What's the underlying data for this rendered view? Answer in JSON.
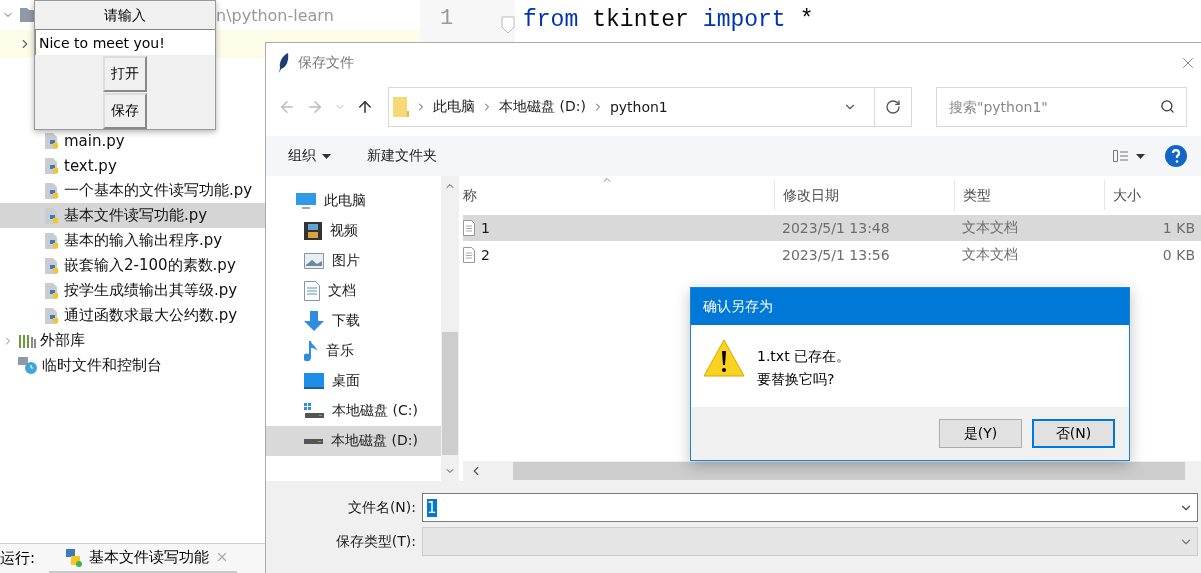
{
  "ide": {
    "path_fragment": "n\\python-learn",
    "files": [
      {
        "name": "main.py",
        "selected": false
      },
      {
        "name": "text.py",
        "selected": false
      },
      {
        "name": "一个基本的文件读写功能.py",
        "selected": false
      },
      {
        "name": "基本文件读写功能.py",
        "selected": true
      },
      {
        "name": "基本的输入输出程序.py",
        "selected": false
      },
      {
        "name": "嵌套输入2-100的素数.py",
        "selected": false
      },
      {
        "name": "按学生成绩输出其等级.py",
        "selected": false
      },
      {
        "name": "通过函数求最大公约数.py",
        "selected": false
      }
    ],
    "other_items": [
      {
        "label": "外部库",
        "kind": "library"
      },
      {
        "label": "临时文件和控制台",
        "kind": "scratch"
      }
    ],
    "editor": {
      "line_number": "1",
      "tokens": [
        {
          "text": "from",
          "kind": "keyword"
        },
        {
          "text": "tkinter",
          "kind": "plain"
        },
        {
          "text": "import",
          "kind": "keyword"
        },
        {
          "text": "*",
          "kind": "plain"
        }
      ]
    },
    "run_bar": {
      "label": "运行:",
      "tab": "基本文件读写功能"
    }
  },
  "tk_window": {
    "title": "请输入",
    "entry_value": "Nice to meet you!",
    "buttons": [
      "打开",
      "保存"
    ]
  },
  "save_dialog": {
    "title": "保存文件",
    "breadcrumbs": [
      "此电脑",
      "本地磁盘 (D:)",
      "python1"
    ],
    "search": {
      "placeholder": "搜索\"python1\""
    },
    "toolbar": {
      "organize": "组织",
      "new_folder": "新建文件夹"
    },
    "nav": [
      {
        "label": "此电脑",
        "kind": "pc",
        "selected": false,
        "children": [
          {
            "label": "视频",
            "kind": "video",
            "selected": false
          },
          {
            "label": "图片",
            "kind": "pictures",
            "selected": false
          },
          {
            "label": "文档",
            "kind": "documents",
            "selected": false
          },
          {
            "label": "下载",
            "kind": "downloads",
            "selected": false
          },
          {
            "label": "音乐",
            "kind": "music",
            "selected": false
          },
          {
            "label": "桌面",
            "kind": "desktop",
            "selected": false
          },
          {
            "label": "本地磁盘 (C:)",
            "kind": "system_drive",
            "selected": false
          },
          {
            "label": "本地磁盘 (D:)",
            "kind": "drive",
            "selected": true
          }
        ]
      }
    ],
    "columns": [
      "称",
      "修改日期",
      "类型",
      "大小"
    ],
    "rows": [
      {
        "name": "1",
        "modified": "2023/5/1 13:48",
        "type": "文本文档",
        "size": "1 KB",
        "selected": true
      },
      {
        "name": "2",
        "modified": "2023/5/1 13:56",
        "type": "文本文档",
        "size": "0 KB",
        "selected": false
      }
    ],
    "filename": {
      "label": "文件名(N):",
      "value": "1",
      "highlighted": true
    },
    "filetype": {
      "label": "保存类型(T):"
    }
  },
  "confirm_dialog": {
    "title": "确认另存为",
    "message": [
      "1.txt 已存在。",
      "要替换它吗?"
    ],
    "buttons": [
      {
        "label": "是(Y)",
        "focused": false
      },
      {
        "label": "否(N)",
        "focused": true
      }
    ]
  }
}
